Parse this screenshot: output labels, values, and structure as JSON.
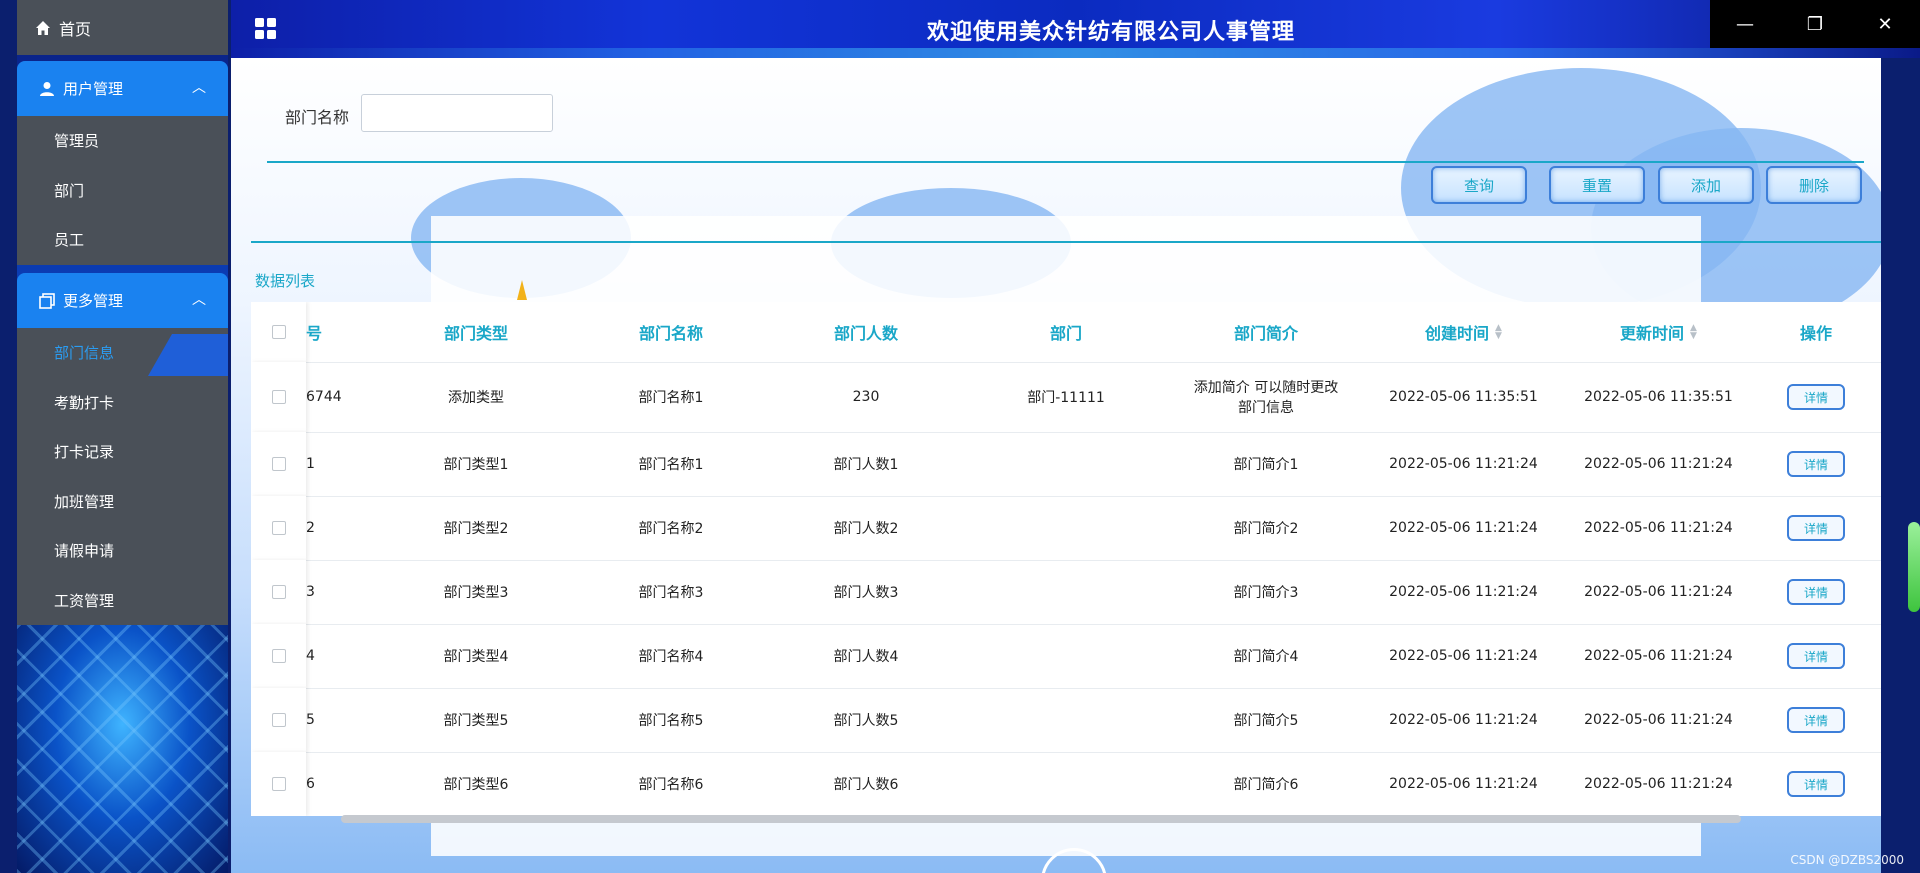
{
  "app": {
    "title": "欢迎使用美众针纺有限公司人事管理"
  },
  "sidebar": {
    "home": "首页",
    "groups": [
      {
        "label": "用户管理",
        "items": [
          "管理员",
          "部门",
          "员工"
        ]
      },
      {
        "label": "更多管理",
        "items": [
          "部门信息",
          "考勤打卡",
          "打卡记录",
          "加班管理",
          "请假申请",
          "工资管理"
        ],
        "active": "部门信息"
      }
    ]
  },
  "search": {
    "label": "部门名称",
    "value": "",
    "placeholder": ""
  },
  "toolbar": {
    "query": "查询",
    "reset": "重置",
    "add": "添加",
    "delete": "删除"
  },
  "list": {
    "title": "数据列表",
    "columns": [
      "号",
      "部门类型",
      "部门名称",
      "部门人数",
      "部门",
      "部门简介",
      "创建时间",
      "更新时间",
      "操作"
    ],
    "detail_label": "详情",
    "rows": [
      [
        "6744",
        "添加类型",
        "部门名称1",
        "230",
        "部门-11111",
        "添加简介 可以随时更改部门信息",
        "2022-05-06 11:35:51",
        "2022-05-06 11:35:51"
      ],
      [
        "1",
        "部门类型1",
        "部门名称1",
        "部门人数1",
        "",
        "部门简介1",
        "2022-05-06 11:21:24",
        "2022-05-06 11:21:24"
      ],
      [
        "2",
        "部门类型2",
        "部门名称2",
        "部门人数2",
        "",
        "部门简介2",
        "2022-05-06 11:21:24",
        "2022-05-06 11:21:24"
      ],
      [
        "3",
        "部门类型3",
        "部门名称3",
        "部门人数3",
        "",
        "部门简介3",
        "2022-05-06 11:21:24",
        "2022-05-06 11:21:24"
      ],
      [
        "4",
        "部门类型4",
        "部门名称4",
        "部门人数4",
        "",
        "部门简介4",
        "2022-05-06 11:21:24",
        "2022-05-06 11:21:24"
      ],
      [
        "5",
        "部门类型5",
        "部门名称5",
        "部门人数5",
        "",
        "部门简介5",
        "2022-05-06 11:21:24",
        "2022-05-06 11:21:24"
      ],
      [
        "6",
        "部门类型6",
        "部门名称6",
        "部门人数6",
        "",
        "部门简介6",
        "2022-05-06 11:21:24",
        "2022-05-06 11:21:24"
      ]
    ]
  },
  "watermark": "CSDN @DZBS2000",
  "colors": {
    "accent": "#1aa7c8",
    "nav_active_bg": "#1a82f0",
    "sidebar_bg": "#4a5058",
    "button_border": "#3d7fd9"
  },
  "icons": [
    "home-icon",
    "user-icon",
    "copy-icon",
    "chevron-up-icon",
    "grid-icon",
    "minimize-icon",
    "restore-icon",
    "close-icon",
    "sort-icon"
  ]
}
